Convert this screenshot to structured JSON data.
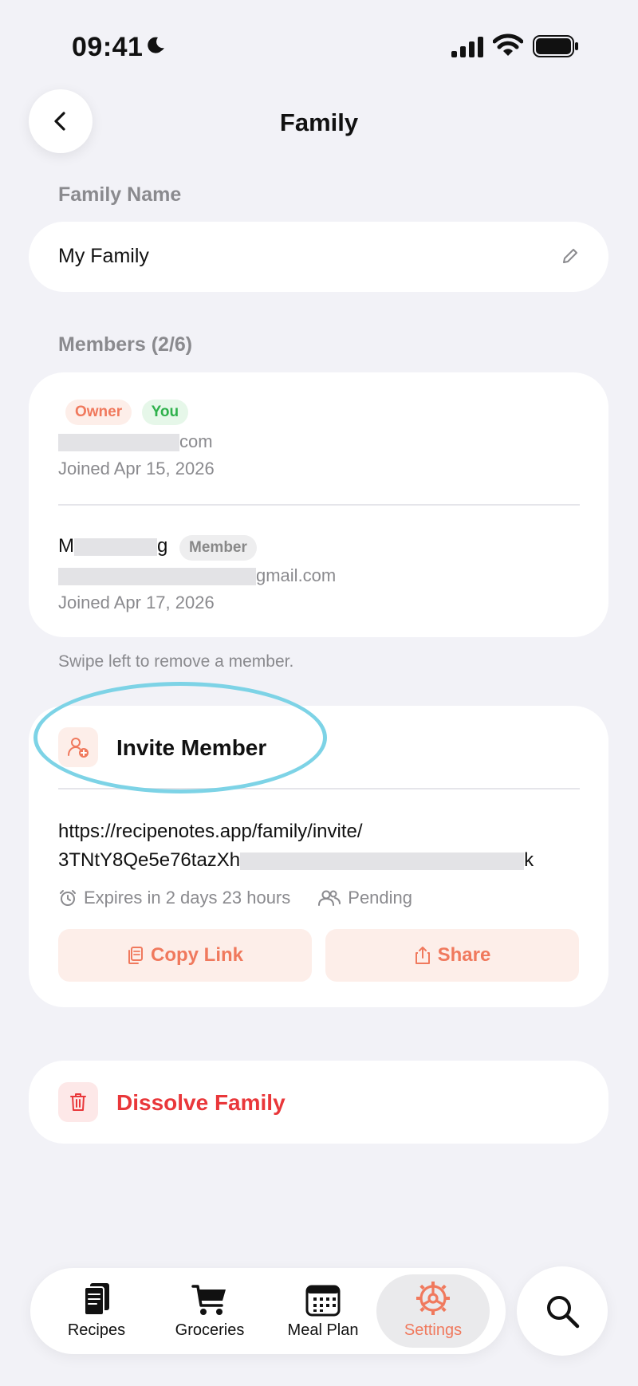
{
  "status_bar": {
    "time": "09:41"
  },
  "header": {
    "title": "Family"
  },
  "family_name": {
    "label": "Family Name",
    "value": "My Family"
  },
  "members": {
    "label": "Members (2/6)",
    "items": [
      {
        "badges": [
          "Owner",
          "You"
        ],
        "email_suffix": "com",
        "joined": "Joined Apr 15, 2026"
      },
      {
        "name_prefix": "M",
        "name_suffix": "g",
        "badge": "Member",
        "email_suffix": "gmail.com",
        "joined": "Joined Apr 17, 2026"
      }
    ],
    "hint": "Swipe left to remove a member."
  },
  "invite": {
    "title": "Invite Member",
    "link_line1": "https://recipenotes.app/family/invite/",
    "link_line2_prefix": "3TNtY8Qe5e76tazXh",
    "link_line2_suffix": "k",
    "expires": "Expires in 2 days 23 hours",
    "status": "Pending",
    "copy_label": "Copy Link",
    "share_label": "Share"
  },
  "danger": {
    "dissolve_label": "Dissolve Family"
  },
  "tabs": [
    {
      "label": "Recipes",
      "icon": "recipes-icon"
    },
    {
      "label": "Groceries",
      "icon": "cart-icon"
    },
    {
      "label": "Meal Plan",
      "icon": "calendar-icon"
    },
    {
      "label": "Settings",
      "icon": "gear-icon",
      "active": true
    }
  ],
  "colors": {
    "accent": "#f0795d",
    "danger": "#e9373a",
    "background": "#f2f2f7",
    "highlight": "#7dd3e6"
  }
}
